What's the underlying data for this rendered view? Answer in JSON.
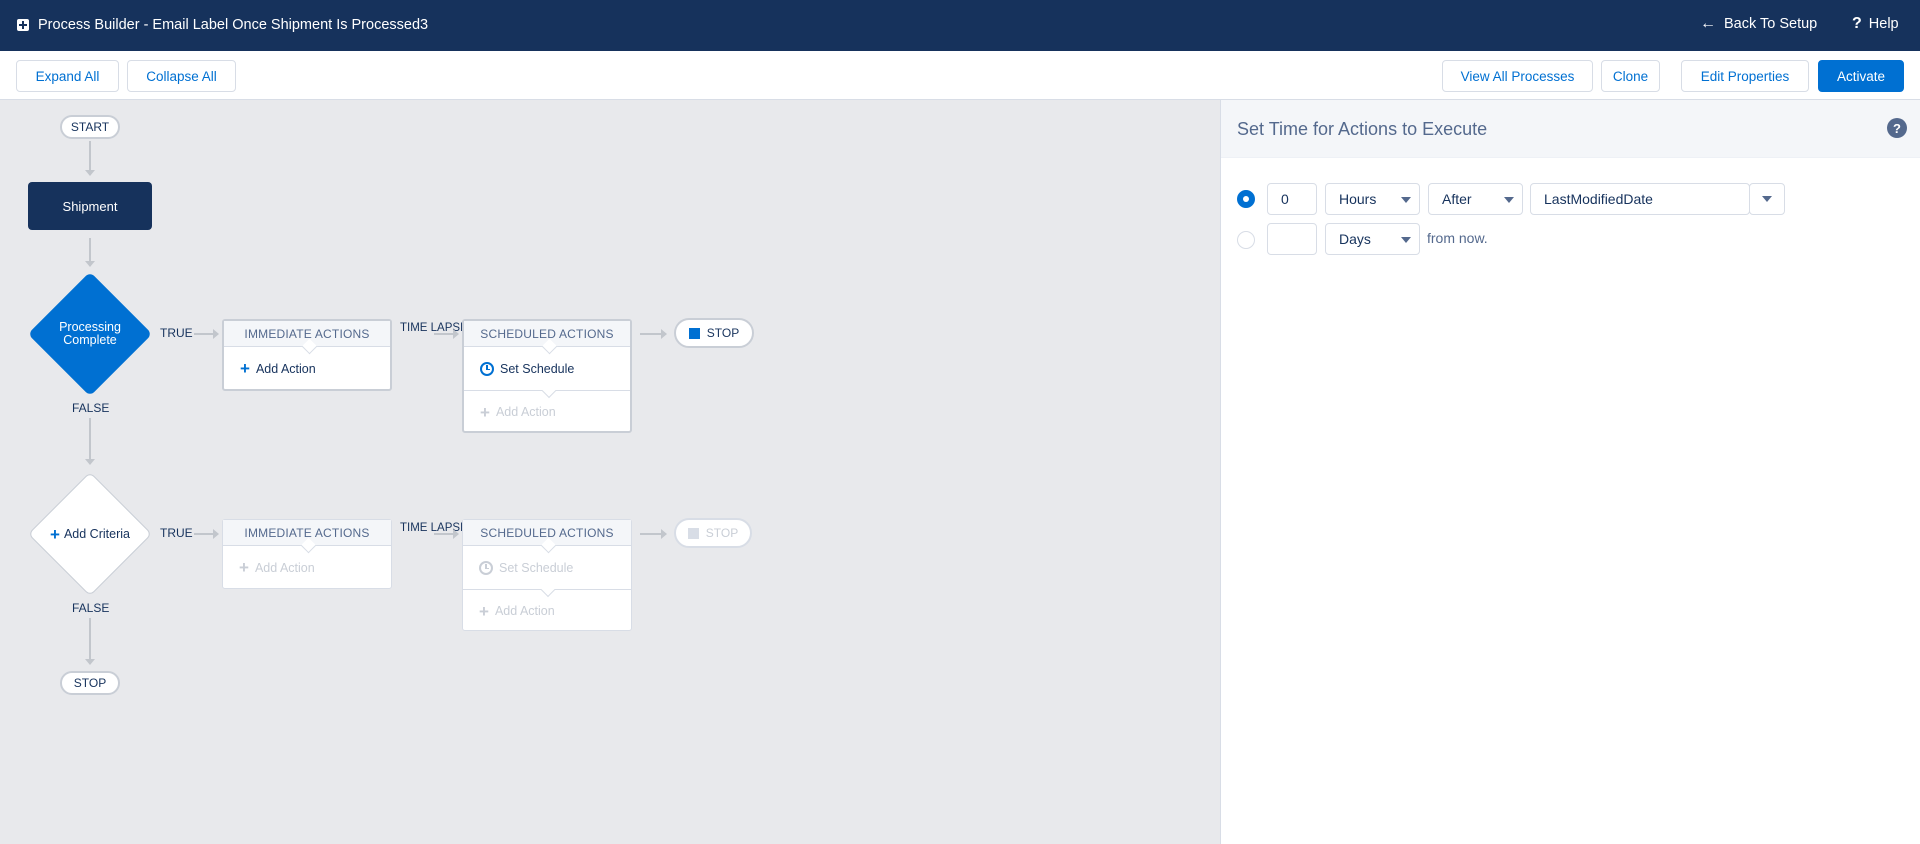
{
  "header": {
    "title": "Process Builder - Email Label Once Shipment Is Processed3",
    "back_label": "Back To Setup",
    "help_label": "Help"
  },
  "toolbar": {
    "expand_all": "Expand All",
    "collapse_all": "Collapse All",
    "view_all_processes": "View All Processes",
    "clone": "Clone",
    "edit_properties": "Edit Properties",
    "activate": "Activate"
  },
  "canvas": {
    "start_label": "START",
    "object_name": "Shipment",
    "criteria": [
      {
        "label": "Processing Complete",
        "true_label": "TRUE",
        "false_label": "FALSE",
        "time_lapse": "TIME LAPSE",
        "immediate_header": "IMMEDIATE ACTIONS",
        "immediate_add": "Add Action",
        "scheduled_header": "SCHEDULED ACTIONS",
        "set_schedule": "Set Schedule",
        "scheduled_add": "Add Action",
        "stop": "STOP"
      },
      {
        "label": "Add Criteria",
        "true_label": "TRUE",
        "false_label": "FALSE",
        "time_lapse": "TIME LAPSE",
        "immediate_header": "IMMEDIATE ACTIONS",
        "immediate_add": "Add Action",
        "scheduled_header": "SCHEDULED ACTIONS",
        "set_schedule": "Set Schedule",
        "scheduled_add": "Add Action",
        "stop": "STOP"
      }
    ],
    "end_stop": "STOP"
  },
  "panel": {
    "title": "Set Time for Actions to Execute",
    "row1": {
      "value": "0",
      "unit": "Hours",
      "relation": "After",
      "field": "LastModifiedDate",
      "selected": true
    },
    "row2": {
      "value": "",
      "unit": "Days",
      "suffix": "from now.",
      "selected": false
    }
  },
  "icons": {
    "back": "arrow-left-icon",
    "help": "question-icon",
    "add": "plus-icon",
    "schedule": "clock-icon",
    "stop": "stop-square-icon"
  },
  "colors": {
    "header_bg": "#16325c",
    "brand": "#0070d2",
    "canvas_bg": "#e8e9ec"
  }
}
